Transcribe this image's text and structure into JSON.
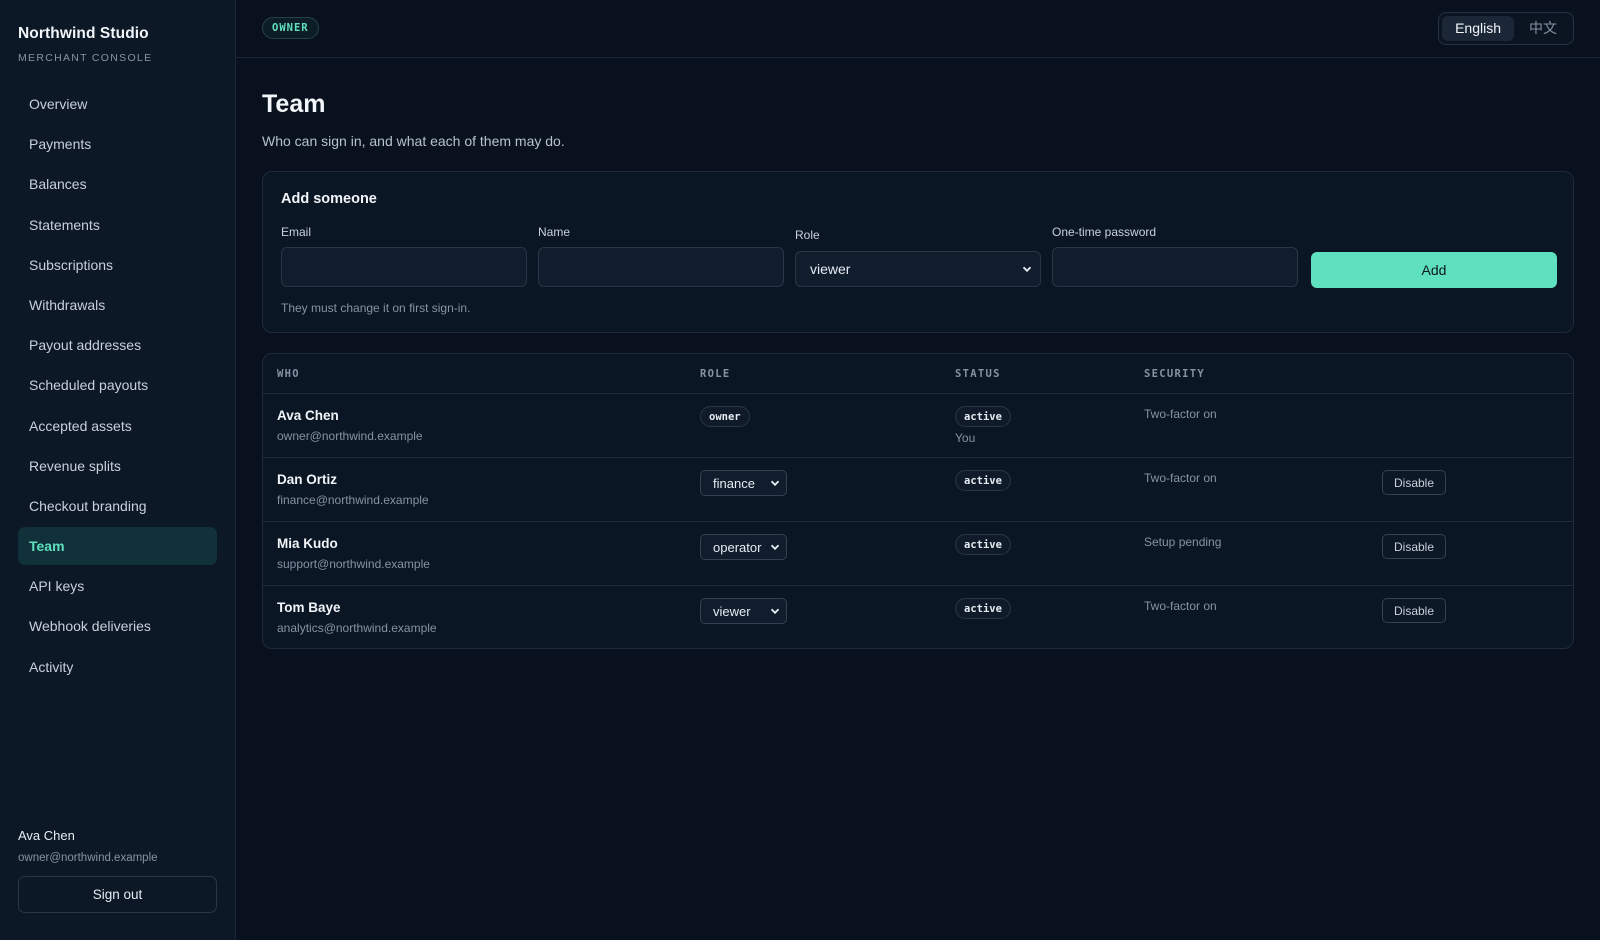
{
  "brand": {
    "name": "Northwind Studio",
    "subtitle": "MERCHANT CONSOLE"
  },
  "sidebar": {
    "items": [
      {
        "label": "Overview"
      },
      {
        "label": "Payments"
      },
      {
        "label": "Balances"
      },
      {
        "label": "Statements"
      },
      {
        "label": "Subscriptions"
      },
      {
        "label": "Withdrawals"
      },
      {
        "label": "Payout addresses"
      },
      {
        "label": "Scheduled payouts"
      },
      {
        "label": "Accepted assets"
      },
      {
        "label": "Revenue splits"
      },
      {
        "label": "Checkout branding"
      },
      {
        "label": "Team",
        "active": true
      },
      {
        "label": "API keys"
      },
      {
        "label": "Webhook deliveries"
      },
      {
        "label": "Activity"
      }
    ],
    "user": {
      "name": "Ava Chen",
      "email": "owner@northwind.example"
    },
    "signout_label": "Sign out"
  },
  "topbar": {
    "role_badge": "OWNER",
    "languages": [
      {
        "label": "English",
        "active": true
      },
      {
        "label": "中文",
        "active": false
      }
    ]
  },
  "page": {
    "title": "Team",
    "subtitle": "Who can sign in, and what each of them may do."
  },
  "add_form": {
    "title": "Add someone",
    "email_label": "Email",
    "email_value": "",
    "name_label": "Name",
    "name_value": "",
    "role_label": "Role",
    "role_value": "viewer",
    "password_label": "One-time password",
    "password_value": "",
    "submit_label": "Add",
    "hint": "They must change it on first sign-in."
  },
  "table": {
    "headers": {
      "who": "WHO",
      "role": "ROLE",
      "status": "STATUS",
      "security": "SECURITY"
    },
    "rows": [
      {
        "name": "Ava Chen",
        "email": "owner@northwind.example",
        "role": "owner",
        "role_editable": false,
        "status": "active",
        "note": "You",
        "security": "Two-factor on",
        "action": ""
      },
      {
        "name": "Dan Ortiz",
        "email": "finance@northwind.example",
        "role": "finance",
        "role_editable": true,
        "status": "active",
        "note": "",
        "security": "Two-factor on",
        "action": "Disable"
      },
      {
        "name": "Mia Kudo",
        "email": "support@northwind.example",
        "role": "operator",
        "role_editable": true,
        "status": "active",
        "note": "",
        "security": "Setup pending",
        "action": "Disable"
      },
      {
        "name": "Tom Baye",
        "email": "analytics@northwind.example",
        "role": "viewer",
        "role_editable": true,
        "status": "active",
        "note": "",
        "security": "Two-factor on",
        "action": "Disable"
      }
    ]
  },
  "colors": {
    "accent": "#5fe0be",
    "background": "#08111d",
    "sidebar": "#0d1826",
    "active_nav": "#10303a"
  },
  "icons": {
    "select": "chevron-down-icon"
  }
}
